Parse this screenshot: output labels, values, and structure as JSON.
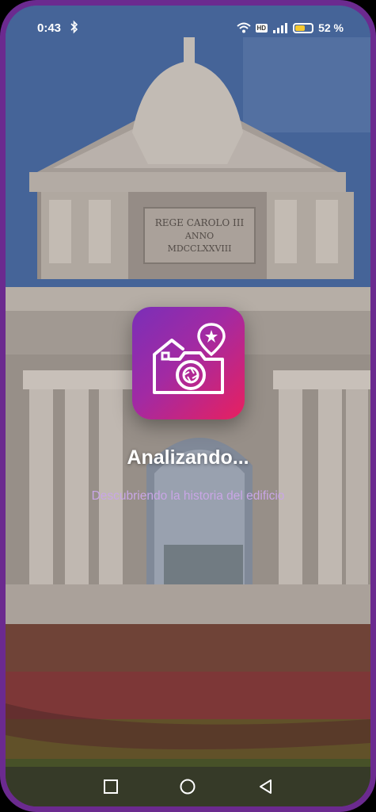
{
  "status_bar": {
    "time": "0:43",
    "hd_label": "HD",
    "battery_percent": "52 %",
    "battery_level": 0.52,
    "icons": [
      "bluetooth-icon",
      "wifi-icon",
      "signal-icon",
      "battery-icon"
    ]
  },
  "loading": {
    "title": "Analizando...",
    "subtitle": "Descubriendo la historia del edificio"
  },
  "monument_inscription": {
    "line1": "REGE CAROLO III",
    "line2": "ANNO",
    "line3": "MDCCLXXVIII"
  },
  "nav_bar": {
    "buttons": [
      "recents-icon",
      "home-icon",
      "back-icon"
    ]
  },
  "colors": {
    "frame": "#6b2a8f",
    "icon_gradient_start": "#7a2fb8",
    "icon_gradient_end": "#e8205f",
    "subtitle": "#c9a6e6",
    "battery": "#f6c930"
  }
}
